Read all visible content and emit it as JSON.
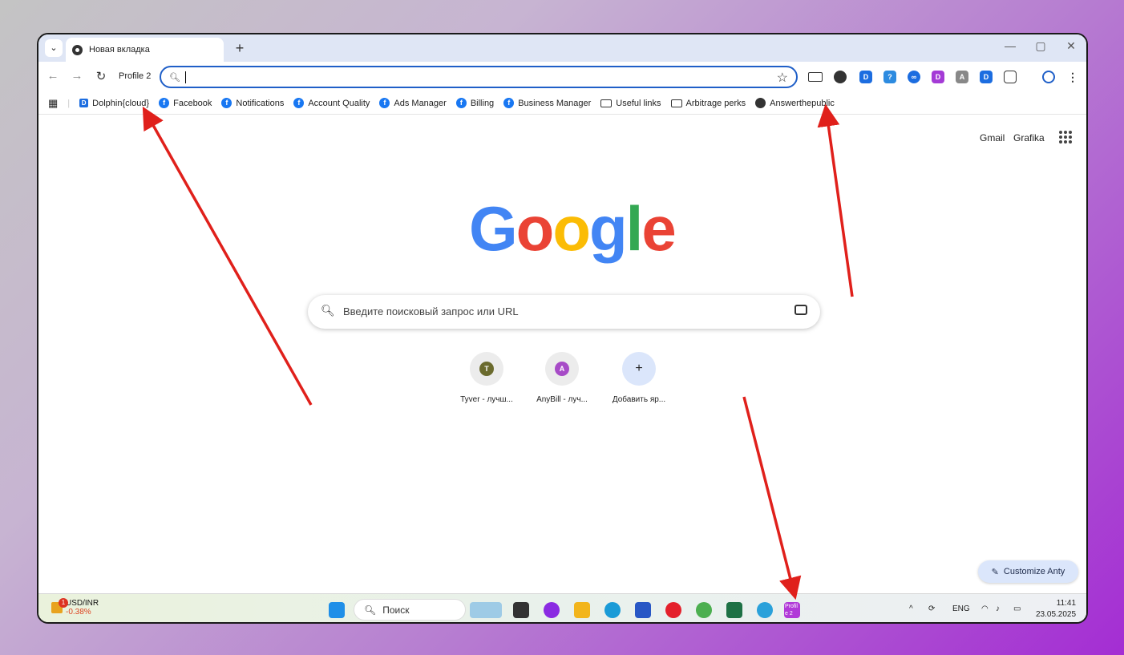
{
  "tab": {
    "title": "Новая вкладка",
    "new_tab": "+"
  },
  "window_controls": {
    "minimize": "—",
    "maximize": "▢",
    "close": "✕"
  },
  "toolbar": {
    "profile": "Profile 2",
    "omnibox_value": ""
  },
  "bookmarks": [
    {
      "label": "Dolphin{cloud}",
      "icon": "dolphin-icon"
    },
    {
      "label": "Facebook",
      "icon": "facebook-icon"
    },
    {
      "label": "Notifications",
      "icon": "facebook-icon"
    },
    {
      "label": "Account Quality",
      "icon": "facebook-icon"
    },
    {
      "label": "Ads Manager",
      "icon": "facebook-icon"
    },
    {
      "label": "Billing",
      "icon": "facebook-icon"
    },
    {
      "label": "Business Manager",
      "icon": "facebook-icon"
    },
    {
      "label": "Useful links",
      "icon": "folder-icon"
    },
    {
      "label": "Arbitrage perks",
      "icon": "folder-icon"
    },
    {
      "label": "Answerthepublic",
      "icon": "globe-icon"
    }
  ],
  "header_links": {
    "gmail": "Gmail",
    "images": "Grafika"
  },
  "logo": {
    "letters": [
      "G",
      "o",
      "o",
      "g",
      "l",
      "e"
    ],
    "colors": [
      "#4285f4",
      "#ea4335",
      "#fbbc05",
      "#4285f4",
      "#34a853",
      "#ea4335"
    ]
  },
  "search": {
    "placeholder": "Введите поисковый запрос или URL"
  },
  "shortcuts": [
    {
      "label": "Tyver - лучш...",
      "initial": "T",
      "color": "#6b6b2e"
    },
    {
      "label": "AnyBill - луч...",
      "initial": "A",
      "color": "#a74bc7"
    },
    {
      "label": "Добавить яр...",
      "initial": "+",
      "color": "#dbe6fb"
    }
  ],
  "customize": {
    "label": "Customize Anty"
  },
  "taskbar": {
    "stock_name": "USD/INR",
    "stock_change": "-0.38%",
    "stock_badge": "1",
    "search": "Поиск",
    "profile_tile": "Profil e 2",
    "lang": "ENG",
    "time": "11:41",
    "date": "23.05.2025"
  }
}
